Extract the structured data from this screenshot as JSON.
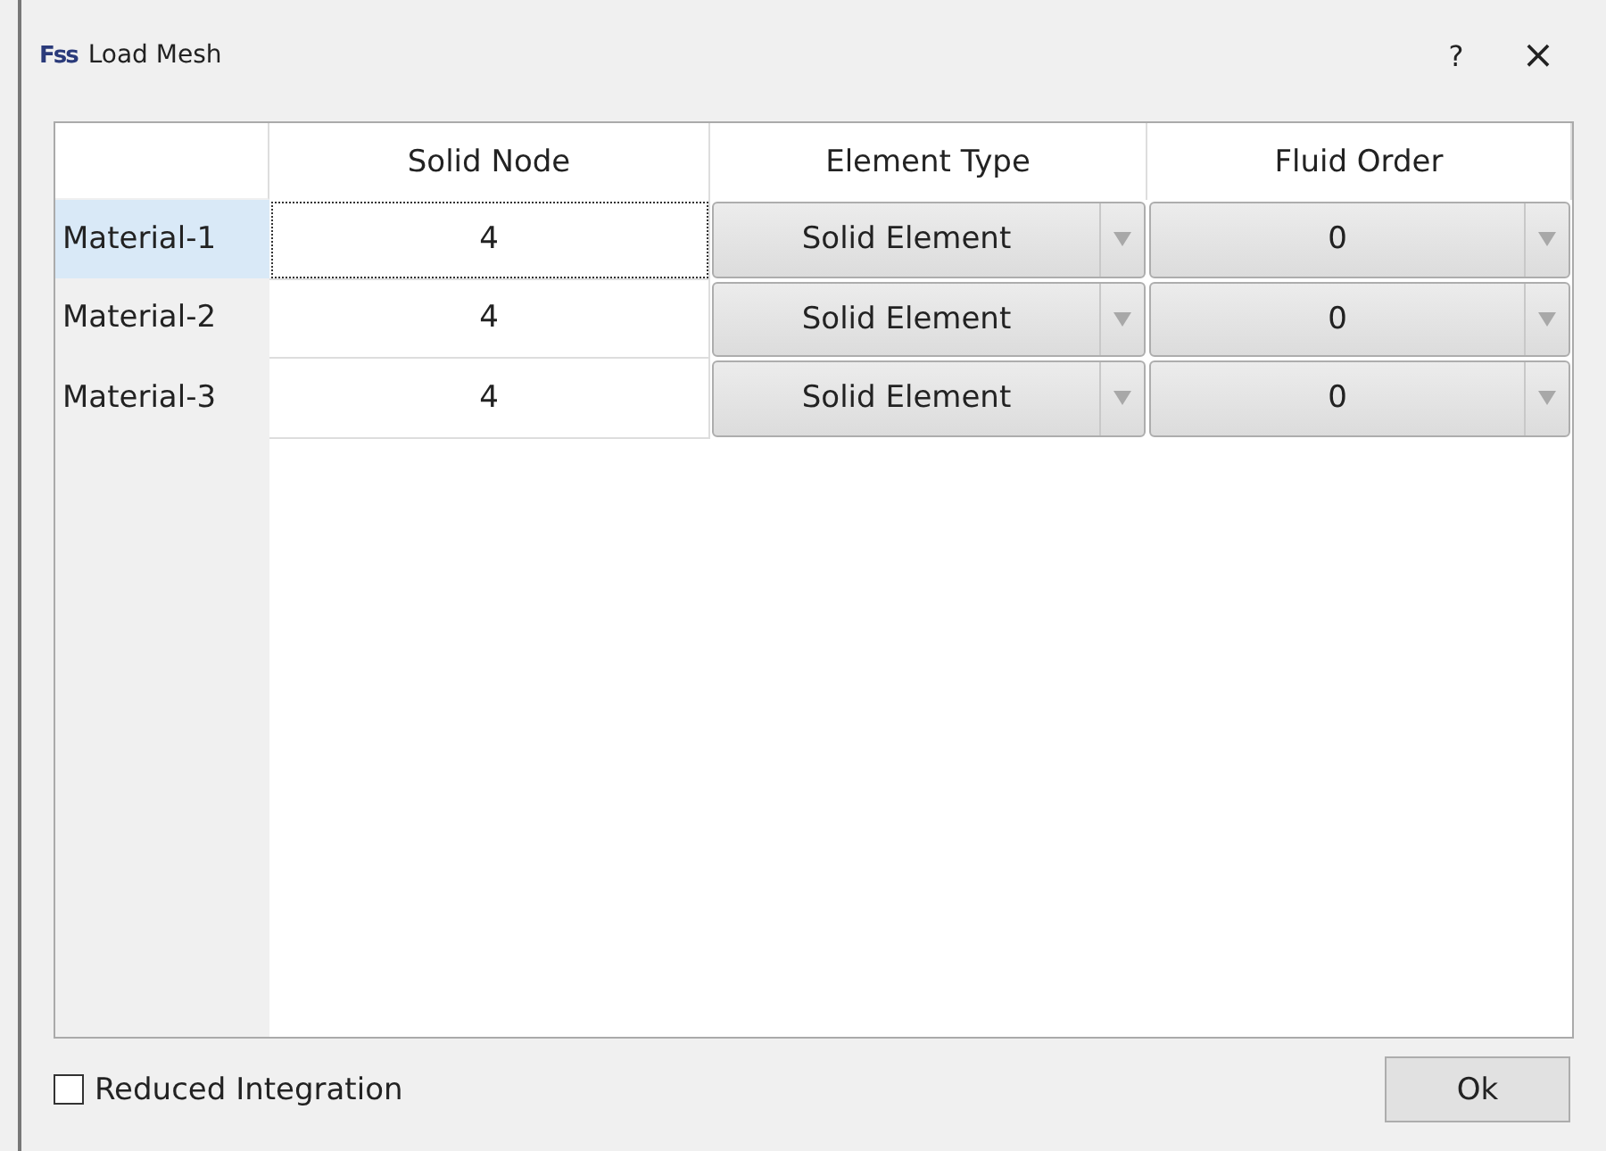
{
  "window": {
    "logo": "Fss",
    "title": "Load Mesh",
    "help": "?",
    "close": "×"
  },
  "table": {
    "columns": [
      "Solid Node",
      "Element Type",
      "Fluid Order"
    ],
    "rows": [
      {
        "label": "Material-1",
        "selected": true,
        "solid_node": "4",
        "element_type": "Solid Element",
        "fluid_order": "0"
      },
      {
        "label": "Material-2",
        "selected": false,
        "solid_node": "4",
        "element_type": "Solid Element",
        "fluid_order": "0"
      },
      {
        "label": "Material-3",
        "selected": false,
        "solid_node": "4",
        "element_type": "Solid Element",
        "fluid_order": "0"
      }
    ]
  },
  "reduced_integration": {
    "label": "Reduced Integration",
    "checked": false
  },
  "buttons": [
    "Ok"
  ]
}
